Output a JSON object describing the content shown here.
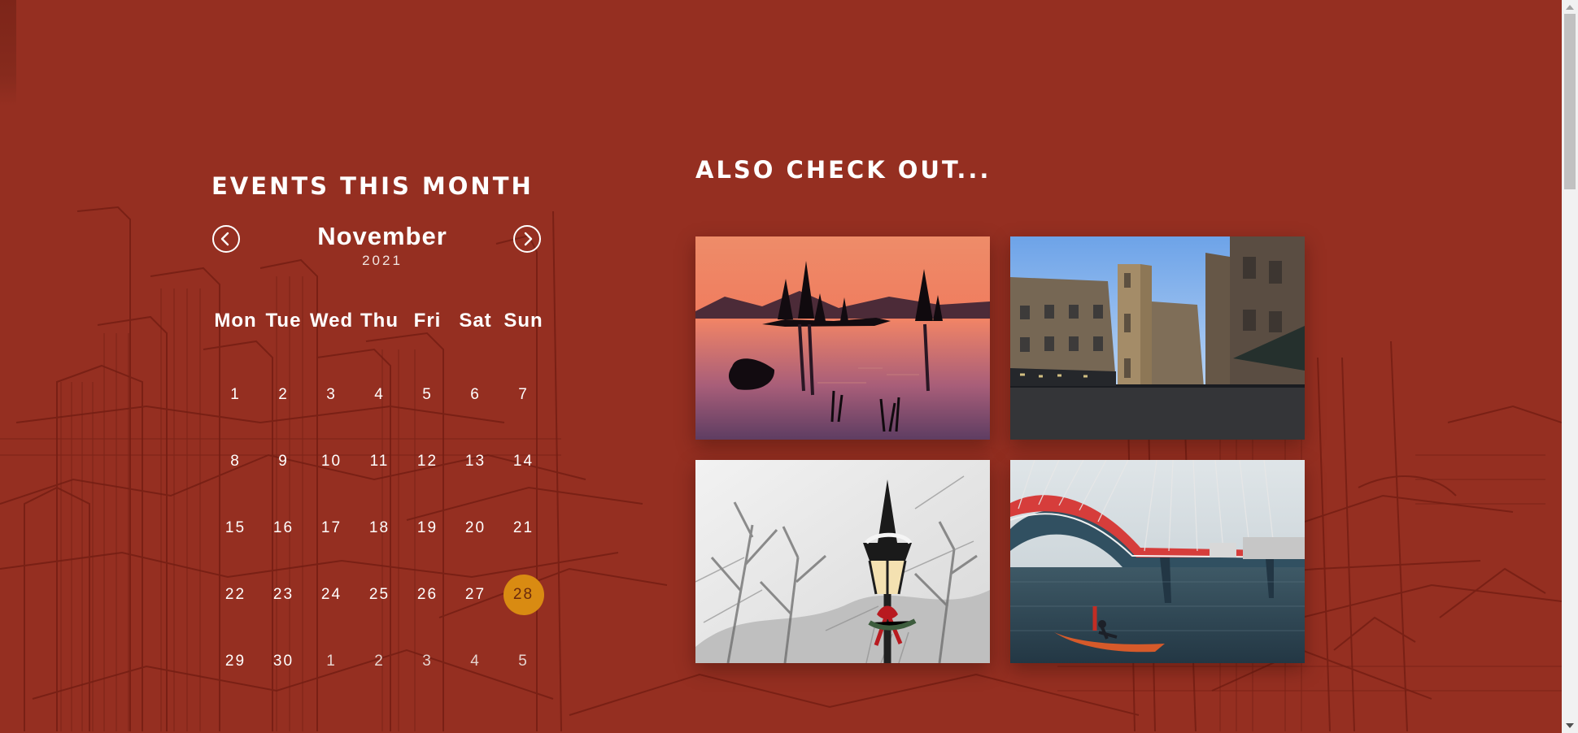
{
  "events": {
    "title": "EVENTS THIS MONTH",
    "month": "November",
    "year": "2021",
    "weekdays": [
      "Mon",
      "Tue",
      "Wed",
      "Thu",
      "Fri",
      "Sat",
      "Sun"
    ],
    "days": [
      {
        "label": "1",
        "muted": false,
        "today": false
      },
      {
        "label": "2",
        "muted": false,
        "today": false
      },
      {
        "label": "3",
        "muted": false,
        "today": false
      },
      {
        "label": "4",
        "muted": false,
        "today": false
      },
      {
        "label": "5",
        "muted": false,
        "today": false
      },
      {
        "label": "6",
        "muted": false,
        "today": false
      },
      {
        "label": "7",
        "muted": false,
        "today": false
      },
      {
        "label": "8",
        "muted": false,
        "today": false
      },
      {
        "label": "9",
        "muted": false,
        "today": false
      },
      {
        "label": "10",
        "muted": false,
        "today": false
      },
      {
        "label": "11",
        "muted": false,
        "today": false
      },
      {
        "label": "12",
        "muted": false,
        "today": false
      },
      {
        "label": "13",
        "muted": false,
        "today": false
      },
      {
        "label": "14",
        "muted": false,
        "today": false
      },
      {
        "label": "15",
        "muted": false,
        "today": false
      },
      {
        "label": "16",
        "muted": false,
        "today": false
      },
      {
        "label": "17",
        "muted": false,
        "today": false
      },
      {
        "label": "18",
        "muted": false,
        "today": false
      },
      {
        "label": "19",
        "muted": false,
        "today": false
      },
      {
        "label": "20",
        "muted": false,
        "today": false
      },
      {
        "label": "21",
        "muted": false,
        "today": false
      },
      {
        "label": "22",
        "muted": false,
        "today": false
      },
      {
        "label": "23",
        "muted": false,
        "today": false
      },
      {
        "label": "24",
        "muted": false,
        "today": false
      },
      {
        "label": "25",
        "muted": false,
        "today": false
      },
      {
        "label": "26",
        "muted": false,
        "today": false
      },
      {
        "label": "27",
        "muted": false,
        "today": false
      },
      {
        "label": "28",
        "muted": false,
        "today": true
      },
      {
        "label": "29",
        "muted": false,
        "today": false
      },
      {
        "label": "30",
        "muted": false,
        "today": false
      },
      {
        "label": "1",
        "muted": true,
        "today": false
      },
      {
        "label": "2",
        "muted": true,
        "today": false
      },
      {
        "label": "3",
        "muted": true,
        "today": false
      },
      {
        "label": "4",
        "muted": true,
        "today": false
      },
      {
        "label": "5",
        "muted": true,
        "today": false
      }
    ]
  },
  "also": {
    "title": "ALSO CHECK OUT..."
  },
  "icons": {
    "prev": "chevron-left-icon",
    "next": "chevron-right-icon",
    "scroll_up": "scroll-up-arrow-icon",
    "scroll_down": "scroll-down-arrow-icon"
  },
  "colors": {
    "background": "#952f21",
    "sketch_lines": "#761f14",
    "today_highlight": "#d98b12",
    "text": "#ffffff"
  }
}
